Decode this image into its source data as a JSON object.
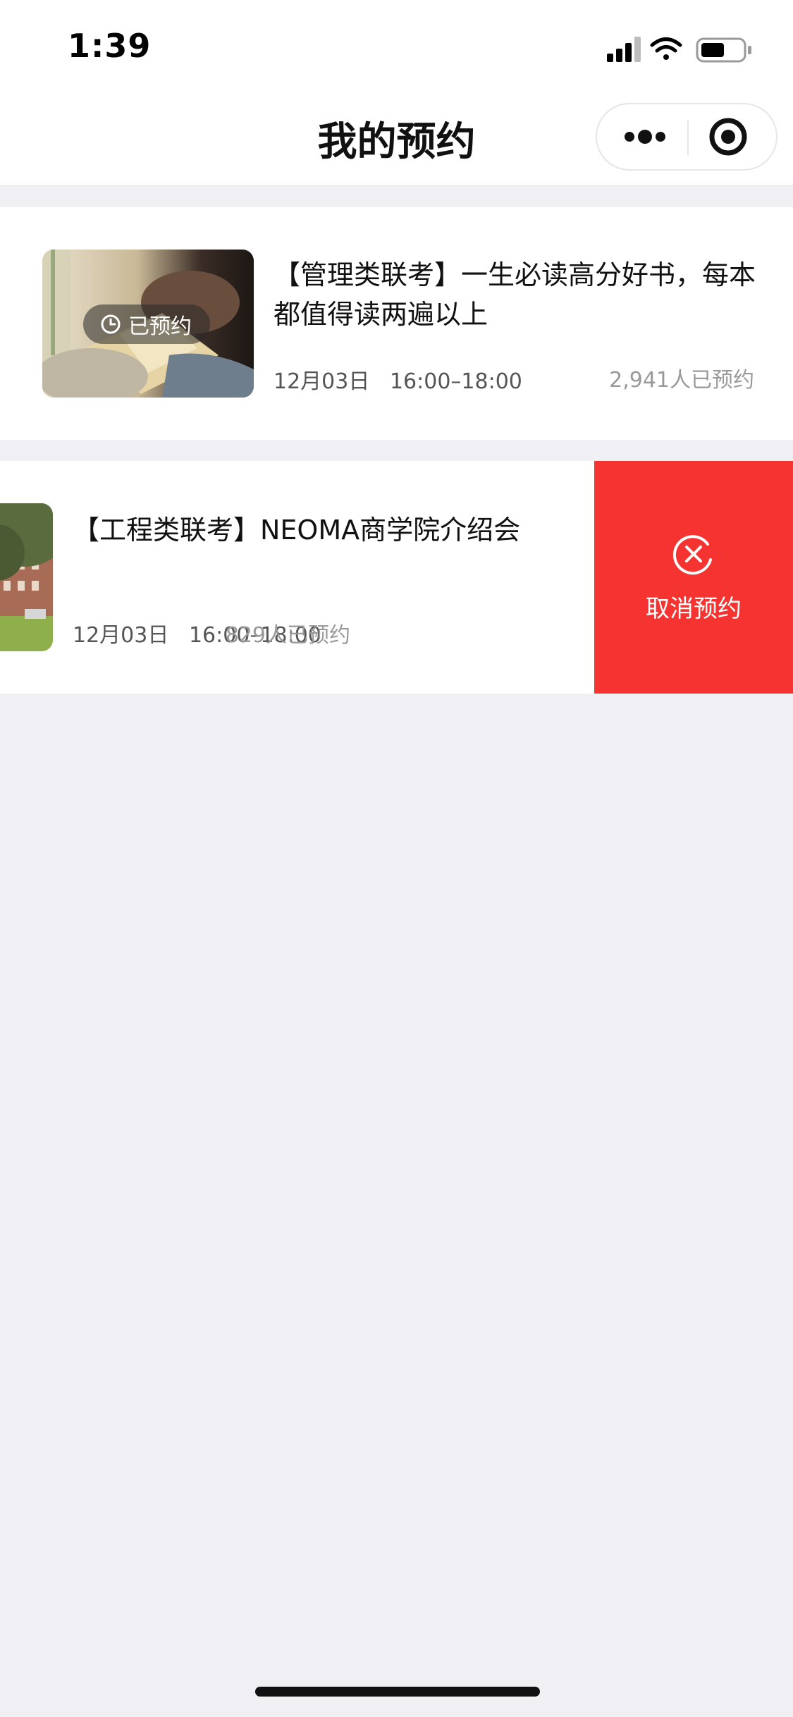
{
  "status_bar": {
    "time": "1:39"
  },
  "navbar": {
    "title": "我的预约",
    "more_icon": "more-dots-icon",
    "close_icon": "target-close-icon"
  },
  "reservations": [
    {
      "title": "【管理类联考】一生必读高分好书，每本都值得读两遍以上",
      "date": "12月03日",
      "time": "16:00–18:00",
      "count": "2,941人已预约",
      "badge": "已预约",
      "badge_icon": "clock-icon"
    },
    {
      "title": "【工程类联考】NEOMA商学院介绍会",
      "date": "12月03日",
      "time": "16:00–18:00",
      "count": "829人已预约",
      "swipe_action": {
        "label": "取消预约",
        "icon": "cancel-circle-icon",
        "color": "#f53431"
      }
    }
  ],
  "colors": {
    "background": "#efeff4",
    "card": "#ffffff",
    "danger": "#f53431"
  }
}
